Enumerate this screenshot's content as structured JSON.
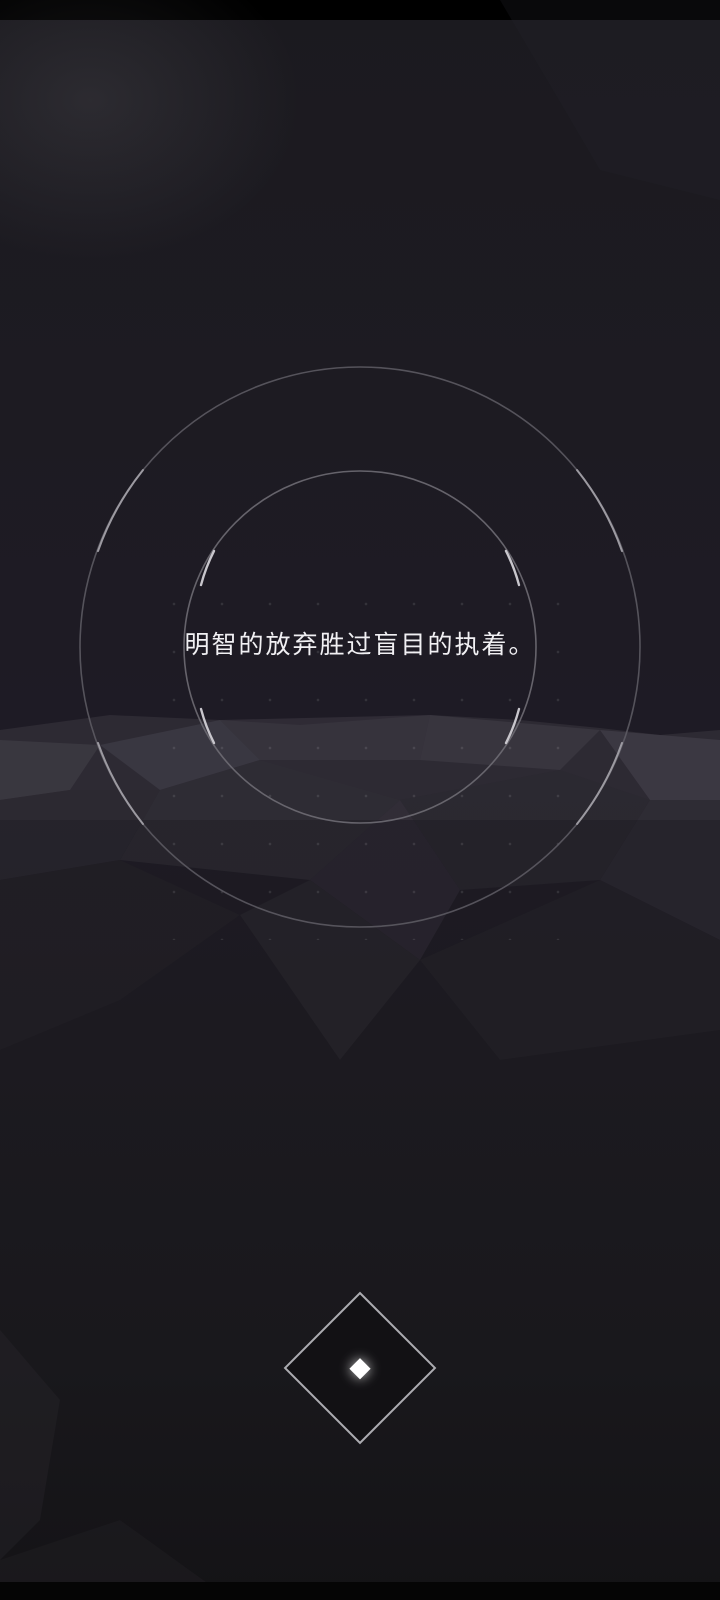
{
  "quote": {
    "text": "明智的放弃胜过盲目的执着。"
  },
  "controls": {
    "diamond_icon": "diamond-icon"
  },
  "colors": {
    "background": "#1c1a20",
    "text": "#f1f0f3",
    "ring_stroke": "#6e6c73",
    "ring_highlight": "#c8c6cc"
  }
}
